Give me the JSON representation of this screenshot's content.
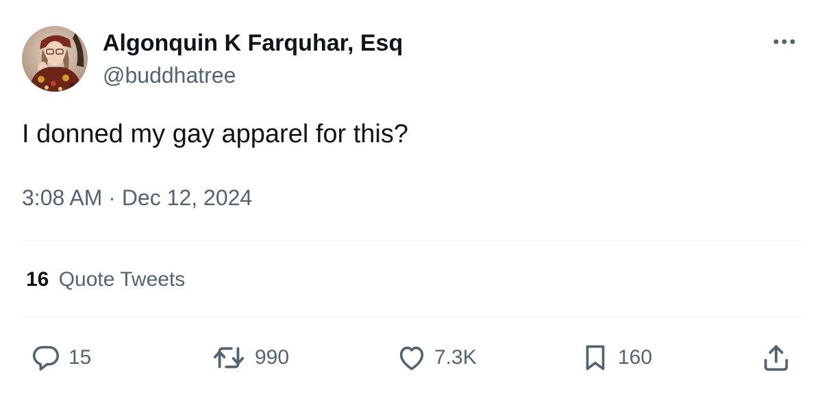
{
  "tweet": {
    "display_name": "Algonquin K Farquhar, Esq",
    "handle": "@buddhatree",
    "text": "I donned my gay apparel for this?",
    "time": "3:08 AM",
    "separator": "·",
    "date": "Dec 12, 2024"
  },
  "quote_tweets": {
    "count": "16",
    "label": "Quote Tweets"
  },
  "actions": {
    "reply": {
      "icon": "reply-icon",
      "count": "15"
    },
    "retweet": {
      "icon": "retweet-icon",
      "count": "990"
    },
    "like": {
      "icon": "heart-icon",
      "count": "7.3K"
    },
    "bookmark": {
      "icon": "bookmark-icon",
      "count": "160"
    },
    "share": {
      "icon": "share-icon"
    }
  },
  "colors": {
    "primary_text": "#0f1419",
    "secondary_text": "#536471",
    "divider": "#eff3f4"
  }
}
